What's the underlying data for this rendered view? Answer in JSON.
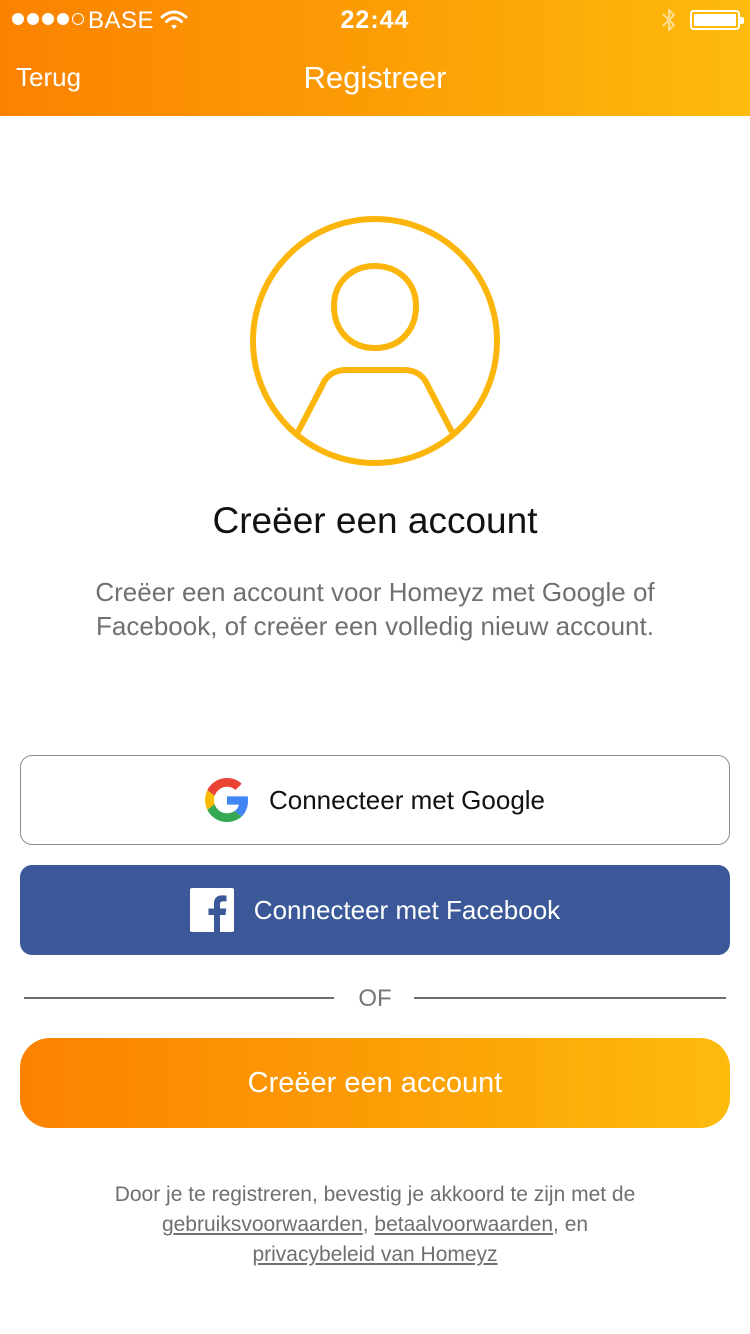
{
  "status_bar": {
    "carrier": "BASE",
    "time": "22:44",
    "icons": [
      "signal-dots-icon",
      "wifi-icon",
      "bluetooth-icon",
      "battery-icon"
    ]
  },
  "nav": {
    "back_label": "Terug",
    "title": "Registreer"
  },
  "main": {
    "avatar_icon": "user-avatar-icon",
    "heading": "Creëer een account",
    "description": "Creëer een account voor Homeyz met Google of Facebook, of creëer een volledig nieuw account."
  },
  "buttons": {
    "google_label": "Connecteer met Google",
    "facebook_label": "Connecteer met Facebook",
    "divider_label": "OF",
    "create_label": "Creëer een account"
  },
  "terms": {
    "prefix": "Door je te registreren, bevestig je akkoord te zijn met de",
    "link_terms": "gebruiksvoorwaarden",
    "sep1": ", ",
    "link_payment": "betaalvoorwaarden",
    "sep2": ", en",
    "link_privacy": "privacybeleid van Homeyz"
  },
  "colors": {
    "accent_orange": "#fb8200",
    "accent_yellow": "#fdbb0c",
    "facebook_blue": "#3b5998"
  }
}
